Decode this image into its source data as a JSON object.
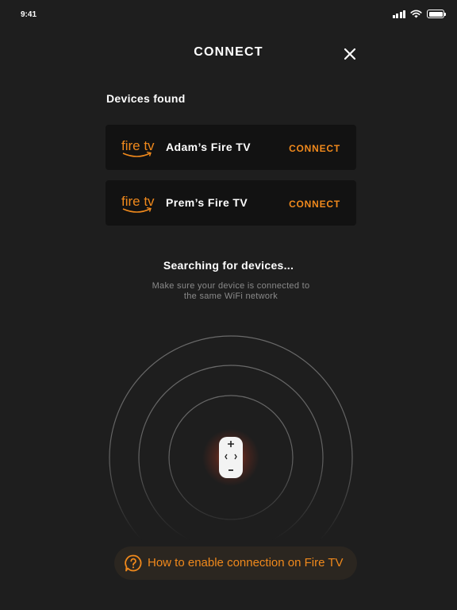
{
  "status_bar": {
    "time": "9:41",
    "icons": [
      "cellular-signal-icon",
      "wifi-icon",
      "battery-icon"
    ],
    "battery_level": 1.0
  },
  "header": {
    "title": "CONNECT",
    "close_icon": "close-icon"
  },
  "devices_section": {
    "label": "Devices found",
    "devices": [
      {
        "logo_text": "fire tv",
        "name": "Adam’s Fire TV",
        "action_label": "CONNECT"
      },
      {
        "logo_text": "fire tv",
        "name": "Prem’s Fire TV",
        "action_label": "CONNECT"
      }
    ]
  },
  "search": {
    "status": "Searching for devices...",
    "hint_line1": "Make sure your device is connected to",
    "hint_line2": "the same WiFi network",
    "illustration_icon": "remote-control-icon"
  },
  "help": {
    "icon": "help-icon",
    "label": "How to enable connection on Fire TV"
  },
  "colors": {
    "background": "#1e1e1e",
    "card_background": "#121212",
    "accent": "#f0891c",
    "help_background": "#2b2620",
    "muted_text": "#8a8a8a"
  }
}
